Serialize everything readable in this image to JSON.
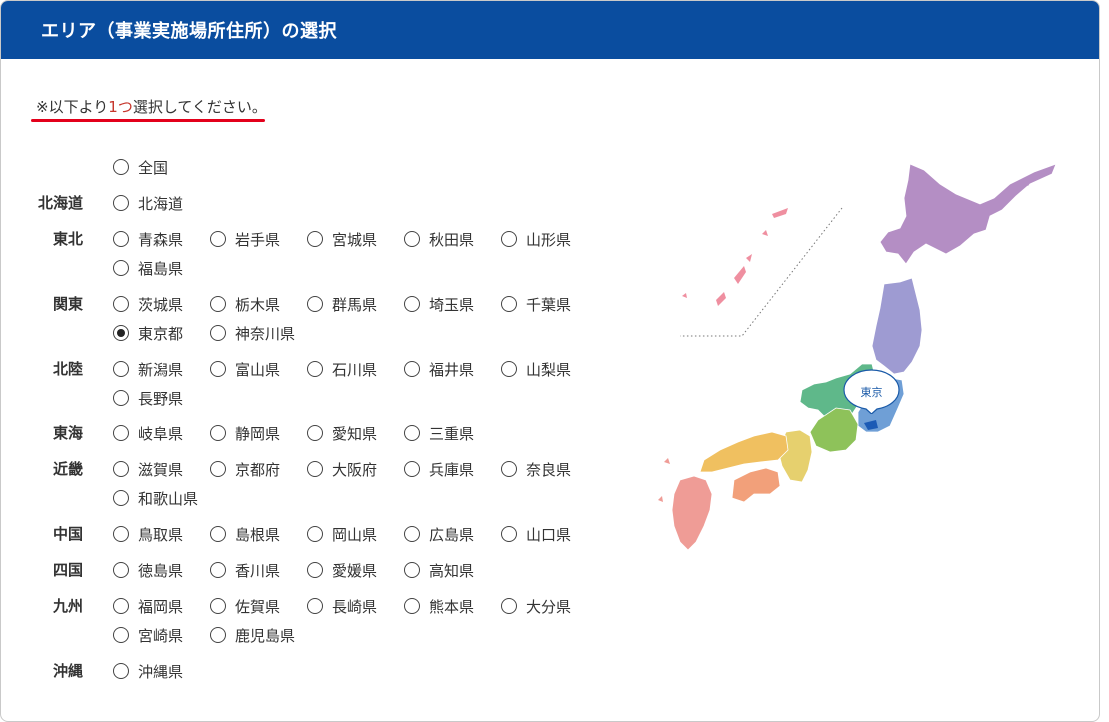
{
  "header": {
    "title": "エリア（事業実施場所住所）の選択"
  },
  "note": {
    "prefix": "※以下より",
    "highlight": "1つ",
    "suffix": "選択してください。"
  },
  "map": {
    "pin_label": "東京"
  },
  "colors": {
    "header_bg": "#0a4d9f",
    "underline": "#e3001b",
    "hokkaido": "#b48ec4",
    "tohoku": "#9e9bd2",
    "kanto": "#6f9fd6",
    "chubu": "#5fb88a",
    "hokuriku": "#8ec25a",
    "kinki": "#e6d06e",
    "chugoku": "#f0c060",
    "shikoku": "#f2a07a",
    "kyushu": "#ef9c96",
    "okinawa": "#ef8fa0"
  },
  "regions": [
    {
      "id": "zenkoku",
      "label": "",
      "options": [
        "全国"
      ]
    },
    {
      "id": "hokkaido",
      "label": "北海道",
      "options": [
        "北海道"
      ]
    },
    {
      "id": "tohoku",
      "label": "東北",
      "options": [
        "青森県",
        "岩手県",
        "宮城県",
        "秋田県",
        "山形県",
        "福島県"
      ]
    },
    {
      "id": "kanto",
      "label": "関東",
      "options": [
        "茨城県",
        "栃木県",
        "群馬県",
        "埼玉県",
        "千葉県",
        "東京都",
        "神奈川県"
      ]
    },
    {
      "id": "hokuriku",
      "label": "北陸",
      "options": [
        "新潟県",
        "富山県",
        "石川県",
        "福井県",
        "山梨県",
        "長野県"
      ]
    },
    {
      "id": "tokai",
      "label": "東海",
      "options": [
        "岐阜県",
        "静岡県",
        "愛知県",
        "三重県"
      ]
    },
    {
      "id": "kinki",
      "label": "近畿",
      "options": [
        "滋賀県",
        "京都府",
        "大阪府",
        "兵庫県",
        "奈良県",
        "和歌山県"
      ]
    },
    {
      "id": "chugoku",
      "label": "中国",
      "options": [
        "鳥取県",
        "島根県",
        "岡山県",
        "広島県",
        "山口県"
      ]
    },
    {
      "id": "shikoku",
      "label": "四国",
      "options": [
        "徳島県",
        "香川県",
        "愛媛県",
        "高知県"
      ]
    },
    {
      "id": "kyushu",
      "label": "九州",
      "options": [
        "福岡県",
        "佐賀県",
        "長崎県",
        "熊本県",
        "大分県",
        "宮崎県",
        "鹿児島県"
      ]
    },
    {
      "id": "okinawa",
      "label": "沖縄",
      "options": [
        "沖縄県"
      ]
    }
  ],
  "selected": "東京都"
}
